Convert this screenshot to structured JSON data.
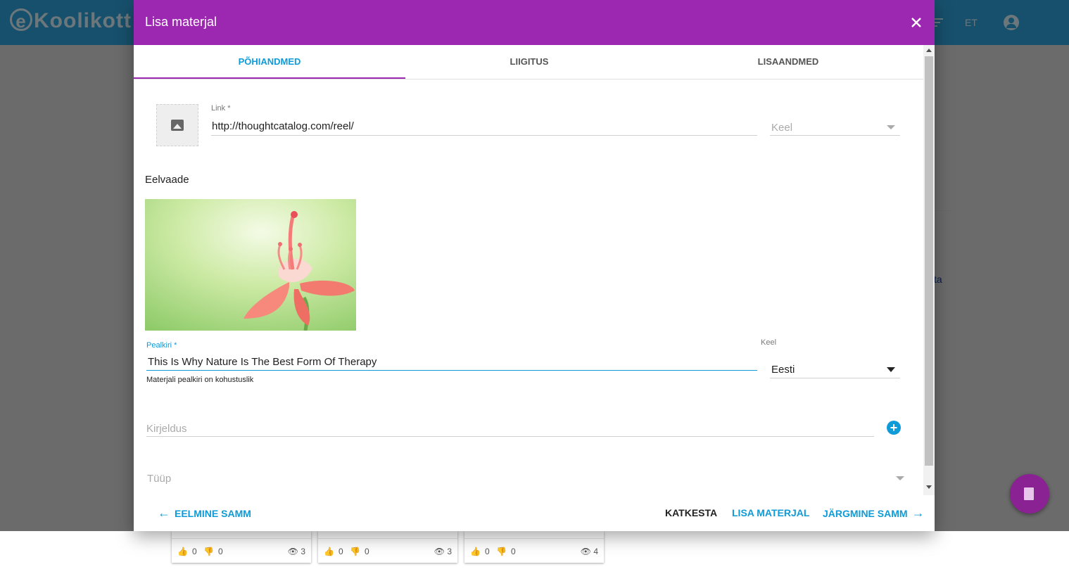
{
  "app": {
    "logo": "Koolikott",
    "language": "ET"
  },
  "background": {
    "link_fragment": "ta",
    "cards": [
      {
        "likes": "0",
        "dislikes": "0",
        "views": "3"
      },
      {
        "likes": "0",
        "dislikes": "0",
        "views": "3"
      },
      {
        "likes": "0",
        "dislikes": "0",
        "views": "4"
      }
    ]
  },
  "dialog": {
    "title": "Lisa materjal",
    "tabs": [
      "PÕHIANDMED",
      "LIIGITUS",
      "LISAANDMED"
    ],
    "active_tab": "PÕHIANDMED",
    "link": {
      "label": "Link *",
      "value": "http://thoughtcatalog.com/reel/"
    },
    "link_language": {
      "placeholder": "Keel"
    },
    "preview_heading": "Eelvaade",
    "title_field": {
      "label": "Pealkiri *",
      "value": "This Is Why Nature Is The Best Form Of Therapy",
      "helper": "Materjali pealkiri on kohustuslik"
    },
    "title_language": {
      "label": "Keel",
      "value": "Eesti"
    },
    "description": {
      "placeholder": "Kirjeldus"
    },
    "type": {
      "placeholder": "Tüüp"
    },
    "buttons": {
      "previous": "EELMINE SAMM",
      "cancel": "KATKESTA",
      "add": "LISA MATERJAL",
      "next": "JÄRGMINE SAMM"
    }
  },
  "colors": {
    "header": "#9c27b0",
    "accent": "#0f9bd7",
    "appbar": "#2fa0d8",
    "fab": "#8a2294"
  }
}
